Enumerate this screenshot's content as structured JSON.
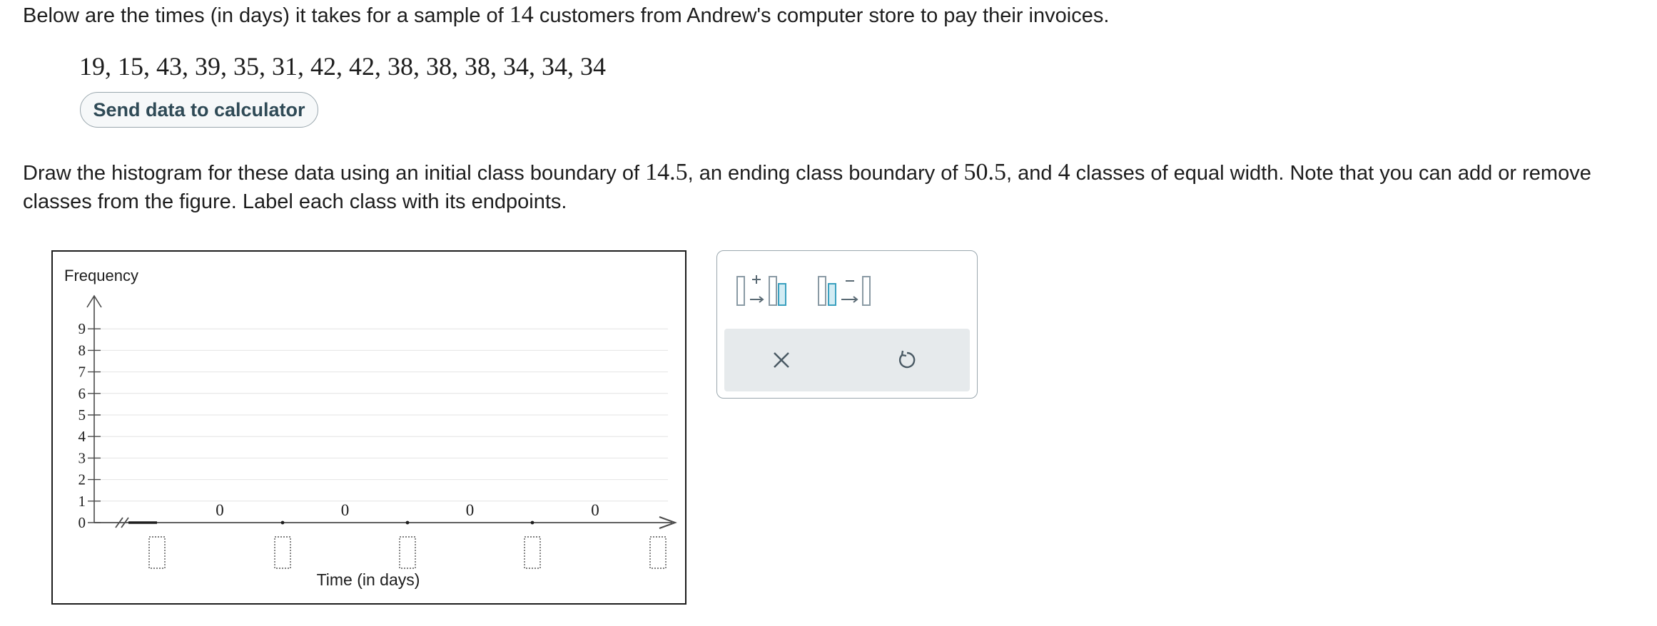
{
  "question": {
    "part1": "Below are the times (in days) it takes for a sample of ",
    "sample_size": "14",
    "part2": " customers from Andrew's computer store to pay their invoices."
  },
  "data_values": "19, 15, 43, 39, 35, 31, 42, 42, 38, 38, 38, 34, 34, 34",
  "send_button_label": "Send data to calculator",
  "instructions": {
    "part1": "Draw the histogram for these data using an initial class boundary of ",
    "initial_boundary": "14.5",
    "part2": ", an ending class boundary of ",
    "ending_boundary": "50.5",
    "part3": ", and ",
    "num_classes": "4",
    "part4": " classes of equal width. Note that you can add or remove classes from the figure. Label each class with its endpoints."
  },
  "chart_data": {
    "type": "bar",
    "ylabel": "Frequency",
    "xlabel": "Time (in days)",
    "yticks": [
      "0",
      "1",
      "2",
      "3",
      "4",
      "5",
      "6",
      "7",
      "8",
      "9"
    ],
    "ylim": [
      0,
      9
    ],
    "bar_labels": [
      "0",
      "0",
      "0",
      "0"
    ],
    "values": [
      0,
      0,
      0,
      0
    ],
    "endpoint_inputs": [
      "",
      "",
      "",
      "",
      ""
    ]
  },
  "toolbar": {
    "add_class_icon": "add-class-icon",
    "remove_class_icon": "remove-class-icon",
    "clear_icon": "x-icon",
    "undo_icon": "undo-icon"
  }
}
